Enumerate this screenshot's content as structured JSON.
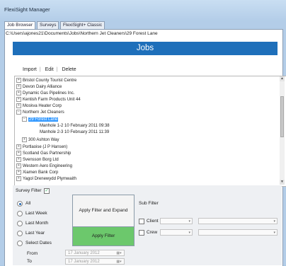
{
  "window": {
    "title": "FlexiSight Manager"
  },
  "tabs": [
    {
      "label": "Job Browser"
    },
    {
      "label": "Surveys"
    },
    {
      "label": "FlexiSight+ Classic"
    }
  ],
  "path": "C:\\Users\\ajones21\\Documents\\Jobs\\Northern Jet Cleaners\\29 Forest Lane",
  "banner": "Jobs",
  "toolbar": {
    "import": "Import",
    "edit": "Edit",
    "delete": "Delete",
    "sep": "|"
  },
  "tree": [
    {
      "label": "Bristol County Tourist Centre",
      "expander": "+"
    },
    {
      "label": "Devon Dairy Alliance",
      "expander": "+"
    },
    {
      "label": "Dynamic Gas Pipelines Inc.",
      "expander": "+"
    },
    {
      "label": "Kentish Farm Products Unit 44",
      "expander": "+"
    },
    {
      "label": "Moskva Heater Corp",
      "expander": "+"
    },
    {
      "label": "Northern Jet Cleaners",
      "expander": "−"
    },
    {
      "label": "29 Forest Lane",
      "expander": "−",
      "selected": true
    },
    {
      "label": "Manhole 1-2   10 February 2011 09:38"
    },
    {
      "label": "Manhole 2-3   10 February 2011 11:39"
    },
    {
      "label": "300 Ashton Way",
      "expander": "+"
    },
    {
      "label": "Portlaoise (J P Hansen)",
      "expander": "+"
    },
    {
      "label": "Scotland Gas Partnership",
      "expander": "+"
    },
    {
      "label": "Svensson Borg Ltd",
      "expander": "+"
    },
    {
      "label": "Western Aero Engineering",
      "expander": "+"
    },
    {
      "label": "Xiamen Bank Corp",
      "expander": "+"
    },
    {
      "label": "Yagol Drenewydd Plymwaith",
      "expander": "+"
    }
  ],
  "filter": {
    "survey_filter_label": "Survey Filter",
    "survey_filter_checked": "✓",
    "options": [
      {
        "label": "All",
        "selected": true
      },
      {
        "label": "Last Week"
      },
      {
        "label": "Last Month"
      },
      {
        "label": "Last Year"
      },
      {
        "label": "Select Dates"
      }
    ],
    "from_label": "From",
    "to_label": "To",
    "from_value": "17  January  2012",
    "to_value": "17  January  2012",
    "apply_expand_label": "Apply Filter and Expand",
    "apply_label": "Apply Filter",
    "sub_filter_label": "Sub Filter",
    "client_label": "Client",
    "crew_label": "Crew"
  },
  "icons": {
    "dropdown": "▾",
    "calendar": "▦▾",
    "scroll_up": "▲",
    "scroll_down": "▼"
  }
}
